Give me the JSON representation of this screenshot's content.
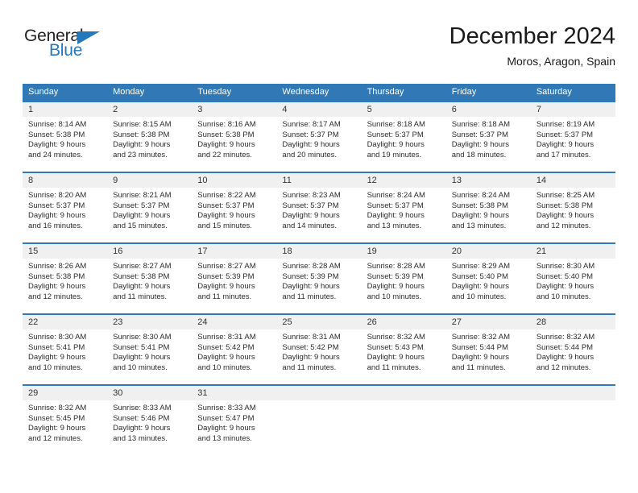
{
  "brand": {
    "name_dark": "General",
    "name_blue": "Blue",
    "accent_color": "#2479bd"
  },
  "header": {
    "title": "December 2024",
    "subtitle": "Moros, Aragon, Spain"
  },
  "theme": {
    "header_bar_color": "#3079b6",
    "day_band_color": "#f0f0f0",
    "text_color": "#2b2b2b"
  },
  "weekdays": [
    "Sunday",
    "Monday",
    "Tuesday",
    "Wednesday",
    "Thursday",
    "Friday",
    "Saturday"
  ],
  "weeks": [
    [
      {
        "day": "1",
        "sunrise": "Sunrise: 8:14 AM",
        "sunset": "Sunset: 5:38 PM",
        "daylight_line1": "Daylight: 9 hours",
        "daylight_line2": "and 24 minutes."
      },
      {
        "day": "2",
        "sunrise": "Sunrise: 8:15 AM",
        "sunset": "Sunset: 5:38 PM",
        "daylight_line1": "Daylight: 9 hours",
        "daylight_line2": "and 23 minutes."
      },
      {
        "day": "3",
        "sunrise": "Sunrise: 8:16 AM",
        "sunset": "Sunset: 5:38 PM",
        "daylight_line1": "Daylight: 9 hours",
        "daylight_line2": "and 22 minutes."
      },
      {
        "day": "4",
        "sunrise": "Sunrise: 8:17 AM",
        "sunset": "Sunset: 5:37 PM",
        "daylight_line1": "Daylight: 9 hours",
        "daylight_line2": "and 20 minutes."
      },
      {
        "day": "5",
        "sunrise": "Sunrise: 8:18 AM",
        "sunset": "Sunset: 5:37 PM",
        "daylight_line1": "Daylight: 9 hours",
        "daylight_line2": "and 19 minutes."
      },
      {
        "day": "6",
        "sunrise": "Sunrise: 8:18 AM",
        "sunset": "Sunset: 5:37 PM",
        "daylight_line1": "Daylight: 9 hours",
        "daylight_line2": "and 18 minutes."
      },
      {
        "day": "7",
        "sunrise": "Sunrise: 8:19 AM",
        "sunset": "Sunset: 5:37 PM",
        "daylight_line1": "Daylight: 9 hours",
        "daylight_line2": "and 17 minutes."
      }
    ],
    [
      {
        "day": "8",
        "sunrise": "Sunrise: 8:20 AM",
        "sunset": "Sunset: 5:37 PM",
        "daylight_line1": "Daylight: 9 hours",
        "daylight_line2": "and 16 minutes."
      },
      {
        "day": "9",
        "sunrise": "Sunrise: 8:21 AM",
        "sunset": "Sunset: 5:37 PM",
        "daylight_line1": "Daylight: 9 hours",
        "daylight_line2": "and 15 minutes."
      },
      {
        "day": "10",
        "sunrise": "Sunrise: 8:22 AM",
        "sunset": "Sunset: 5:37 PM",
        "daylight_line1": "Daylight: 9 hours",
        "daylight_line2": "and 15 minutes."
      },
      {
        "day": "11",
        "sunrise": "Sunrise: 8:23 AM",
        "sunset": "Sunset: 5:37 PM",
        "daylight_line1": "Daylight: 9 hours",
        "daylight_line2": "and 14 minutes."
      },
      {
        "day": "12",
        "sunrise": "Sunrise: 8:24 AM",
        "sunset": "Sunset: 5:37 PM",
        "daylight_line1": "Daylight: 9 hours",
        "daylight_line2": "and 13 minutes."
      },
      {
        "day": "13",
        "sunrise": "Sunrise: 8:24 AM",
        "sunset": "Sunset: 5:38 PM",
        "daylight_line1": "Daylight: 9 hours",
        "daylight_line2": "and 13 minutes."
      },
      {
        "day": "14",
        "sunrise": "Sunrise: 8:25 AM",
        "sunset": "Sunset: 5:38 PM",
        "daylight_line1": "Daylight: 9 hours",
        "daylight_line2": "and 12 minutes."
      }
    ],
    [
      {
        "day": "15",
        "sunrise": "Sunrise: 8:26 AM",
        "sunset": "Sunset: 5:38 PM",
        "daylight_line1": "Daylight: 9 hours",
        "daylight_line2": "and 12 minutes."
      },
      {
        "day": "16",
        "sunrise": "Sunrise: 8:27 AM",
        "sunset": "Sunset: 5:38 PM",
        "daylight_line1": "Daylight: 9 hours",
        "daylight_line2": "and 11 minutes."
      },
      {
        "day": "17",
        "sunrise": "Sunrise: 8:27 AM",
        "sunset": "Sunset: 5:39 PM",
        "daylight_line1": "Daylight: 9 hours",
        "daylight_line2": "and 11 minutes."
      },
      {
        "day": "18",
        "sunrise": "Sunrise: 8:28 AM",
        "sunset": "Sunset: 5:39 PM",
        "daylight_line1": "Daylight: 9 hours",
        "daylight_line2": "and 11 minutes."
      },
      {
        "day": "19",
        "sunrise": "Sunrise: 8:28 AM",
        "sunset": "Sunset: 5:39 PM",
        "daylight_line1": "Daylight: 9 hours",
        "daylight_line2": "and 10 minutes."
      },
      {
        "day": "20",
        "sunrise": "Sunrise: 8:29 AM",
        "sunset": "Sunset: 5:40 PM",
        "daylight_line1": "Daylight: 9 hours",
        "daylight_line2": "and 10 minutes."
      },
      {
        "day": "21",
        "sunrise": "Sunrise: 8:30 AM",
        "sunset": "Sunset: 5:40 PM",
        "daylight_line1": "Daylight: 9 hours",
        "daylight_line2": "and 10 minutes."
      }
    ],
    [
      {
        "day": "22",
        "sunrise": "Sunrise: 8:30 AM",
        "sunset": "Sunset: 5:41 PM",
        "daylight_line1": "Daylight: 9 hours",
        "daylight_line2": "and 10 minutes."
      },
      {
        "day": "23",
        "sunrise": "Sunrise: 8:30 AM",
        "sunset": "Sunset: 5:41 PM",
        "daylight_line1": "Daylight: 9 hours",
        "daylight_line2": "and 10 minutes."
      },
      {
        "day": "24",
        "sunrise": "Sunrise: 8:31 AM",
        "sunset": "Sunset: 5:42 PM",
        "daylight_line1": "Daylight: 9 hours",
        "daylight_line2": "and 10 minutes."
      },
      {
        "day": "25",
        "sunrise": "Sunrise: 8:31 AM",
        "sunset": "Sunset: 5:42 PM",
        "daylight_line1": "Daylight: 9 hours",
        "daylight_line2": "and 11 minutes."
      },
      {
        "day": "26",
        "sunrise": "Sunrise: 8:32 AM",
        "sunset": "Sunset: 5:43 PM",
        "daylight_line1": "Daylight: 9 hours",
        "daylight_line2": "and 11 minutes."
      },
      {
        "day": "27",
        "sunrise": "Sunrise: 8:32 AM",
        "sunset": "Sunset: 5:44 PM",
        "daylight_line1": "Daylight: 9 hours",
        "daylight_line2": "and 11 minutes."
      },
      {
        "day": "28",
        "sunrise": "Sunrise: 8:32 AM",
        "sunset": "Sunset: 5:44 PM",
        "daylight_line1": "Daylight: 9 hours",
        "daylight_line2": "and 12 minutes."
      }
    ],
    [
      {
        "day": "29",
        "sunrise": "Sunrise: 8:32 AM",
        "sunset": "Sunset: 5:45 PM",
        "daylight_line1": "Daylight: 9 hours",
        "daylight_line2": "and 12 minutes."
      },
      {
        "day": "30",
        "sunrise": "Sunrise: 8:33 AM",
        "sunset": "Sunset: 5:46 PM",
        "daylight_line1": "Daylight: 9 hours",
        "daylight_line2": "and 13 minutes."
      },
      {
        "day": "31",
        "sunrise": "Sunrise: 8:33 AM",
        "sunset": "Sunset: 5:47 PM",
        "daylight_line1": "Daylight: 9 hours",
        "daylight_line2": "and 13 minutes."
      },
      {
        "day": "",
        "sunrise": "",
        "sunset": "",
        "daylight_line1": "",
        "daylight_line2": ""
      },
      {
        "day": "",
        "sunrise": "",
        "sunset": "",
        "daylight_line1": "",
        "daylight_line2": ""
      },
      {
        "day": "",
        "sunrise": "",
        "sunset": "",
        "daylight_line1": "",
        "daylight_line2": ""
      },
      {
        "day": "",
        "sunrise": "",
        "sunset": "",
        "daylight_line1": "",
        "daylight_line2": ""
      }
    ]
  ]
}
